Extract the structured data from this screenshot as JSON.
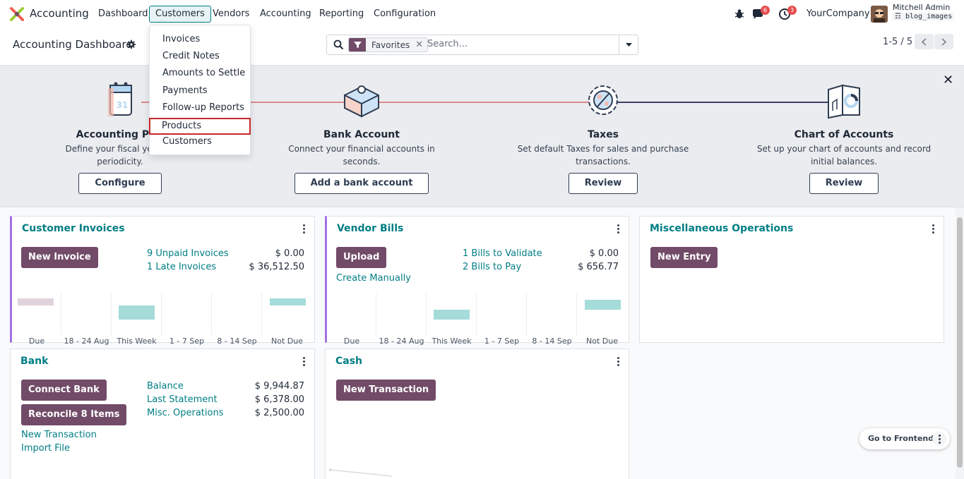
{
  "navbar": {
    "app_name": "Accounting",
    "menu": [
      "Dashboard",
      "Customers",
      "Vendors",
      "Accounting",
      "Reporting",
      "Configuration"
    ],
    "active_menu": "Customers",
    "messages_count": "6",
    "activities_count": "3",
    "company": "YourCompany",
    "user_name": "Mitchell Admin",
    "database": "blog_images"
  },
  "control": {
    "title": "Accounting Dashboard",
    "facet_label": "Favorites",
    "search_placeholder": "Search...",
    "pager": "1-5 / 5"
  },
  "customers_menu": {
    "items": [
      "Invoices",
      "Credit Notes",
      "Amounts to Settle",
      "Payments",
      "Follow-up Reports",
      "Products",
      "Customers"
    ],
    "highlighted": "Products"
  },
  "onboarding": {
    "steps": [
      {
        "title": "Accounting Periods",
        "title_visible": "Accounting Peri",
        "desc_line1": "Define your fiscal years &",
        "desc_line2": "periodicity.",
        "button": "Configure"
      },
      {
        "title": "Bank Account",
        "desc_line1": "Connect your financial accounts in",
        "desc_line2": "seconds.",
        "button": "Add a bank account"
      },
      {
        "title": "Taxes",
        "desc_line1": "Set default Taxes for sales and purchase",
        "desc_line2": "transactions.",
        "button": "Review"
      },
      {
        "title": "Chart of Accounts",
        "desc_line1": "Set up your chart of accounts and record",
        "desc_line2": "initial balances.",
        "button": "Review"
      }
    ],
    "calendar_day": "31"
  },
  "cards": {
    "customer_invoices": {
      "title": "Customer Invoices",
      "button": "New Invoice",
      "rows": [
        {
          "label": "9 Unpaid Invoices",
          "amount": "$ 0.00"
        },
        {
          "label": "1 Late Invoices",
          "amount": "$ 36,512.50"
        }
      ],
      "graph_labels": [
        "Due",
        "18 - 24 Aug",
        "This Week",
        "1 - 7 Sep",
        "8 - 14 Sep",
        "Not Due"
      ]
    },
    "vendor_bills": {
      "title": "Vendor Bills",
      "button": "Upload",
      "secondary_link": "Create Manually",
      "rows": [
        {
          "label": "1 Bills to Validate",
          "amount": "$ 0.00"
        },
        {
          "label": "2 Bills to Pay",
          "amount": "$ 656.77"
        }
      ],
      "graph_labels": [
        "Due",
        "18 - 24 Aug",
        "This Week",
        "1 - 7 Sep",
        "8 - 14 Sep",
        "Not Due"
      ]
    },
    "misc": {
      "title": "Miscellaneous Operations",
      "button": "New Entry"
    },
    "bank": {
      "title": "Bank",
      "button1": "Connect Bank",
      "button2": "Reconcile 8 Items",
      "links": [
        "New Transaction",
        "Import File"
      ],
      "rows": [
        {
          "label": "Balance",
          "amount": "$ 9,944.87"
        },
        {
          "label": "Last Statement",
          "amount": "$ 6,378.00"
        },
        {
          "label": "Misc. Operations",
          "amount": "$ 2,500.00"
        }
      ]
    },
    "cash": {
      "title": "Cash",
      "button": "New Transaction"
    }
  },
  "floating": {
    "frontend": "Go to Frontend"
  },
  "colors": {
    "brand": "#714b67",
    "teal": "#017e84",
    "accent_border": "#a371e4",
    "highlight": "#c62828"
  }
}
